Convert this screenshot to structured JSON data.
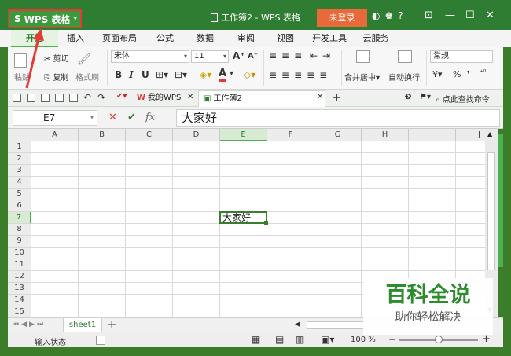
{
  "titlebar": {
    "app_button": "WPS 表格",
    "logo_glyph": "S",
    "window_title": "工作簿2 - WPS 表格",
    "login_label": "未登录",
    "help_glyph": "?",
    "brand_color": "#2f7d32",
    "annotation_color": "#e53935"
  },
  "ribbon_tabs": [
    "开始",
    "插入",
    "页面布局",
    "公式",
    "数据",
    "审阅",
    "视图",
    "开发工具",
    "云服务"
  ],
  "ribbon": {
    "paste": "粘贴",
    "cut": "剪切",
    "copy": "复制",
    "format_painter": "格式刷",
    "font_name": "宋体",
    "font_size": "11",
    "bold": "B",
    "italic": "I",
    "underline": "U",
    "merge_center": "合并居中",
    "wrap_text": "自动换行",
    "number_format": "常规",
    "percent": "%"
  },
  "doc_tabs": {
    "tab1": "我的WPS",
    "tab2": "工作簿2",
    "search": "点此查找命令"
  },
  "formula_bar": {
    "name_box": "E7",
    "fx": "fx",
    "value": "大家好"
  },
  "grid": {
    "columns": [
      "A",
      "B",
      "C",
      "D",
      "E",
      "F",
      "G",
      "H",
      "I",
      "J"
    ],
    "rows": [
      "1",
      "2",
      "3",
      "4",
      "5",
      "6",
      "7",
      "8",
      "9",
      "10",
      "11",
      "12",
      "13",
      "14",
      "15"
    ],
    "selected_column": "E",
    "selected_row": "7",
    "active_cell_text": "大家好"
  },
  "sheet_bar": {
    "sheet_name": "sheet1",
    "add_glyph": "+"
  },
  "status_bar": {
    "mode": "输入状态",
    "zoom": "100 %",
    "zoom_level": 0.5
  },
  "watermark": {
    "title": "百科全说",
    "subtitle": "助你轻松解决"
  }
}
